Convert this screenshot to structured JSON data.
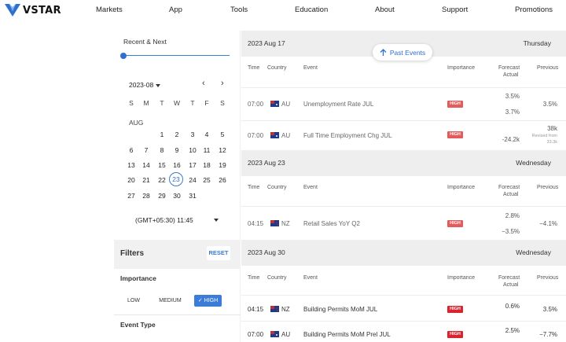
{
  "header": {
    "logo_text": "VSTAR",
    "nav": [
      "Markets",
      "App",
      "Tools",
      "Education",
      "About",
      "Support",
      "Promotions"
    ]
  },
  "sidebar": {
    "recent_next_label": "Recent & Next",
    "month_select": "2023-08",
    "dow": [
      "S",
      "M",
      "T",
      "W",
      "T",
      "F",
      "S"
    ],
    "month_label": "AUG",
    "weeks": [
      [
        "",
        "",
        "1",
        "2",
        "3",
        "4",
        "5"
      ],
      [
        "6",
        "7",
        "8",
        "9",
        "10",
        "11",
        "12"
      ],
      [
        "13",
        "14",
        "15",
        "16",
        "17",
        "18",
        "19"
      ],
      [
        "20",
        "21",
        "22",
        "23",
        "24",
        "25",
        "26"
      ],
      [
        "27",
        "28",
        "29",
        "30",
        "31",
        "",
        ""
      ]
    ],
    "selected_day": "23",
    "timezone": "(GMT+05:30) 11:45",
    "filters_title": "Filters",
    "reset_label": "RESET",
    "importance_title": "Importance",
    "importance_low": "LOW",
    "importance_medium": "MEDIUM",
    "importance_high": "HIGH",
    "event_type_title": "Event Type"
  },
  "past_events_label": "Past Events",
  "columns": {
    "time": "Time",
    "country": "Country",
    "event": "Event",
    "importance": "Importance",
    "forecast": "Forecast",
    "actual": "Actual",
    "previous": "Previous"
  },
  "groups": [
    {
      "date": "2023 Aug 17",
      "weekday": "Thursday",
      "rows": [
        {
          "time": "07:00",
          "country": "AU",
          "event": "Unemployment Rate JUL",
          "importance": "HIGH",
          "forecast": "3.5%",
          "actual": "3.7%",
          "previous": "3.5%",
          "revised": ""
        },
        {
          "time": "07:00",
          "country": "AU",
          "event": "Full Time Employment Chg JUL",
          "importance": "HIGH",
          "forecast": "",
          "actual": "-24.2k",
          "previous": "38k",
          "revised": "Revised from 33.3k"
        }
      ]
    },
    {
      "date": "2023 Aug 23",
      "weekday": "Wednesday",
      "rows": [
        {
          "time": "04:15",
          "country": "NZ",
          "event": "Retail Sales YoY Q2",
          "importance": "HIGH",
          "forecast": "2.8%",
          "actual": "−3.5%",
          "previous": "−4.1%",
          "revised": ""
        }
      ]
    },
    {
      "date": "2023 Aug 30",
      "weekday": "Wednesday",
      "rows": [
        {
          "time": "04:15",
          "country": "NZ",
          "event": "Building Permits MoM JUL",
          "importance": "HIGH",
          "forecast": "0.6%",
          "actual": "",
          "previous": "3.5%",
          "revised": ""
        },
        {
          "time": "07:00",
          "country": "AU",
          "event": "Building Permits MoM Prel JUL",
          "importance": "HIGH",
          "forecast": "2.5%",
          "actual": "",
          "previous": "−7.7%",
          "revised": ""
        }
      ]
    }
  ],
  "colors": {
    "accent": "#3b7cd8",
    "high_badge": "#e55a5a",
    "high_badge_dark": "#d9232f"
  }
}
